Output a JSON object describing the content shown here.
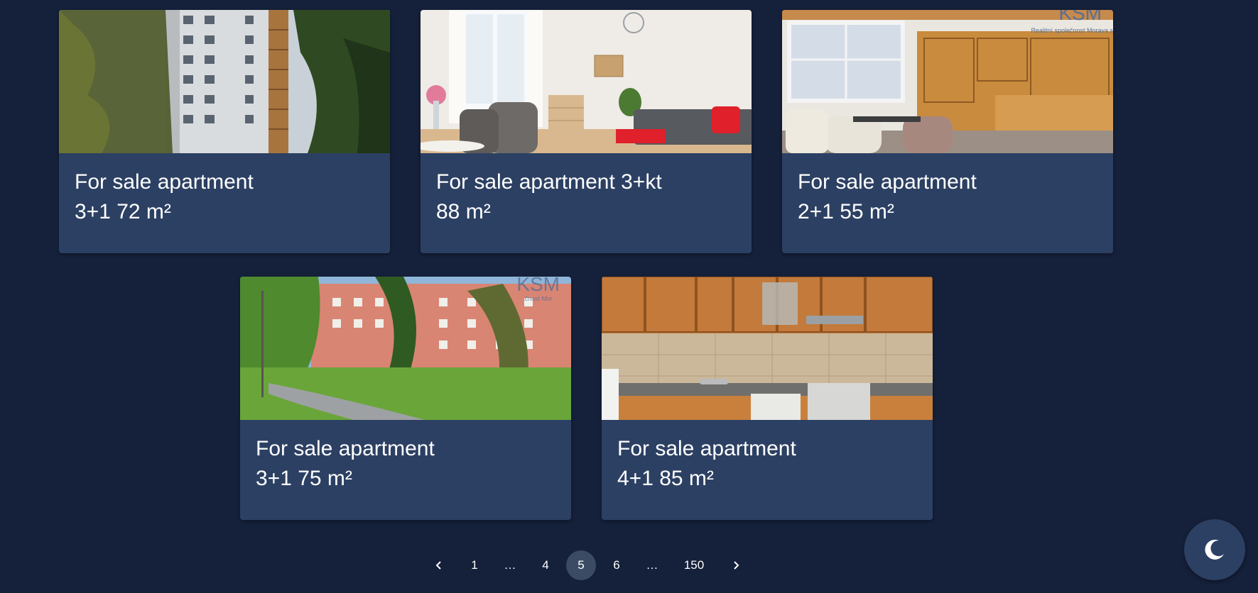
{
  "listings": [
    {
      "line1": "For sale apartment",
      "line2": "3+1 72 m²",
      "image": "apartment-tower-exterior"
    },
    {
      "line1": "For sale apartment 3+kt",
      "line2": "88 m²",
      "image": "living-room-interior"
    },
    {
      "line1": "For sale apartment",
      "line2": "2+1 55 m²",
      "image": "living-room-wooden-cabinets",
      "watermark": {
        "logo": "KSM",
        "tagline": "Realitní společnost Morava s"
      }
    },
    {
      "line1": "For sale apartment",
      "line2": "3+1 75 m²",
      "image": "brick-building-park",
      "watermark": {
        "logo": "KSM",
        "tagline": "čnost Mor"
      }
    },
    {
      "line1": "For sale apartment",
      "line2": "4+1 85 m²",
      "image": "kitchen-interior"
    }
  ],
  "pagination": {
    "prev_icon": "chevron-left-icon",
    "next_icon": "chevron-right-icon",
    "pages": [
      "1",
      "…",
      "4",
      "5",
      "6",
      "…",
      "150"
    ],
    "current": "5"
  },
  "theme_toggle": {
    "icon": "moon-icon"
  },
  "colors": {
    "background": "#15203a",
    "card": "#2c4063",
    "active_page": "#3b4b63",
    "text": "#ffffff"
  }
}
